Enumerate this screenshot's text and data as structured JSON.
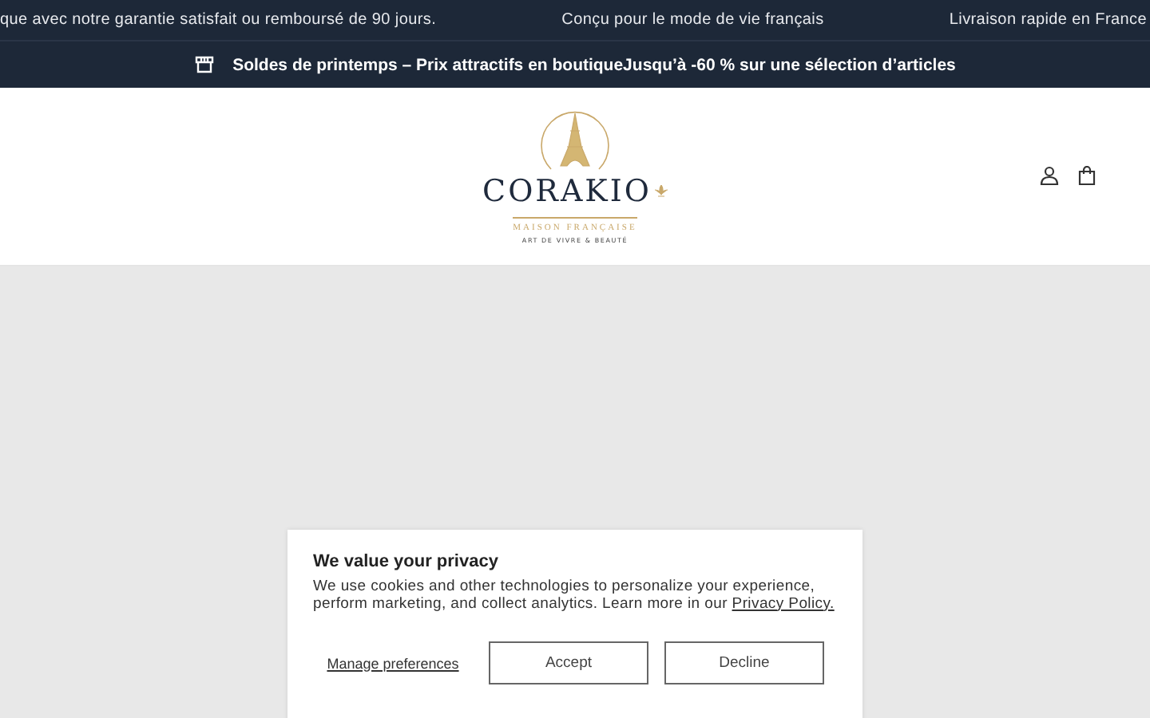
{
  "announcement_bar": {
    "messages": [
      "que avec notre garantie satisfait ou remboursé de 90 jours.",
      "Conçu pour le mode de vie français",
      "Livraison rapide en France"
    ]
  },
  "promo_bar": {
    "text": "Soldes de printemps – Prix attractifs en boutiqueJusqu’à -60 % sur une sélection d’articles"
  },
  "header": {
    "logo": {
      "name": "CORAKIO",
      "tagline": "MAISON FRANÇAISE",
      "subtitle": "ART DE VIVRE & BEAUTÉ"
    }
  },
  "cookie_banner": {
    "title": "We value your privacy",
    "text": "We use cookies and other technologies to personalize your experience, perform marketing, and collect analytics. Learn more in our",
    "link": "Privacy Policy.",
    "manage": "Manage preferences",
    "buttons": [
      "Accept",
      "Decline"
    ]
  }
}
